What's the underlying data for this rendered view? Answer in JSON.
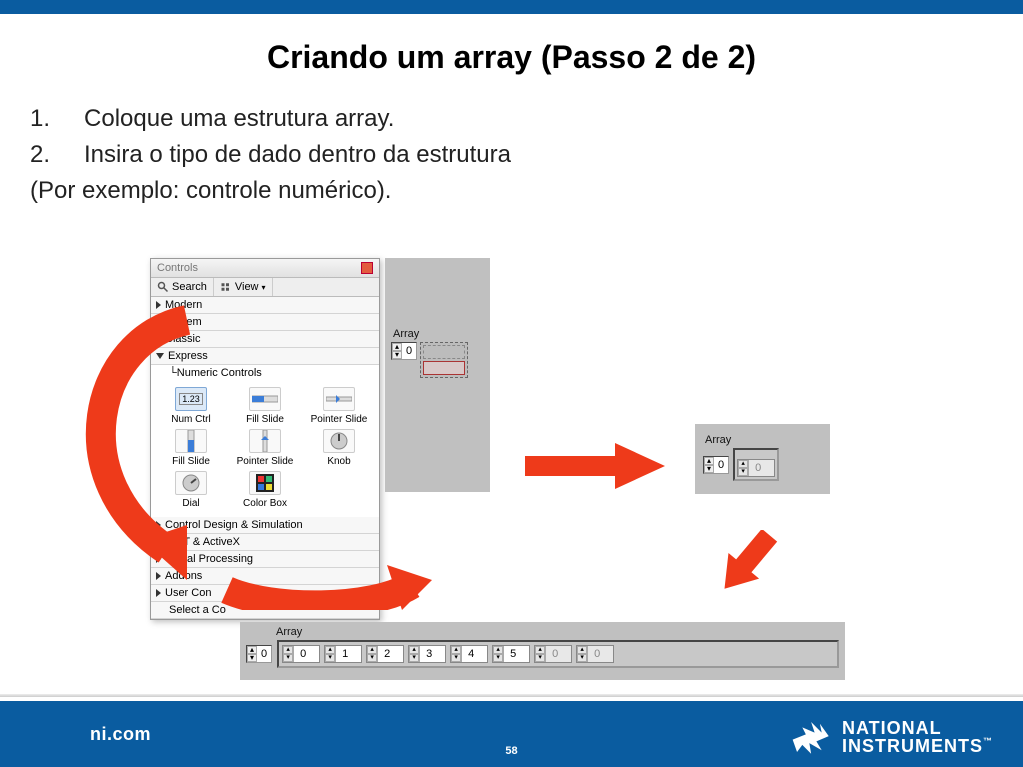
{
  "slide": {
    "title": "Criando um array (Passo 2 de 2)",
    "step1_num": "1.",
    "step1_text": "Coloque uma estrutura array.",
    "step2_num": "2.",
    "step2_text": "Insira o tipo de dado dentro da estrutura",
    "example": "(Por exemplo: controle numérico).",
    "page_number": "58"
  },
  "controls": {
    "panel_title": "Controls",
    "search": "Search",
    "view": "View",
    "tree": {
      "modern": "Modern",
      "system": "System",
      "classic": "Classic",
      "express": "Express",
      "numeric_controls": "Numeric Controls",
      "cds": "Control Design & Simulation",
      "dotnet": ".NET & ActiveX",
      "sigproc": "Signal Processing",
      "addons": "Addons",
      "usercon": "User Con",
      "selecta": "Select a Co"
    },
    "grid": {
      "num_ctrl": "Num Ctrl",
      "fill_slide": "Fill Slide",
      "pointer_slide": "Pointer Slide",
      "fill_slide2": "Fill Slide",
      "pointer_slide2": "Pointer Slide",
      "knob": "Knob",
      "dial": "Dial",
      "color_box": "Color Box"
    }
  },
  "arrays": {
    "label": "Array",
    "idx_a": "0",
    "idx_b": "0",
    "small_val_0": "0",
    "hrow": [
      "0",
      "1",
      "2",
      "3",
      "4",
      "5",
      "0",
      "0"
    ]
  },
  "footer": {
    "domain": "ni.com",
    "brand1": "NATIONAL",
    "brand2": "INSTRUMENTS",
    "tm": "™"
  }
}
